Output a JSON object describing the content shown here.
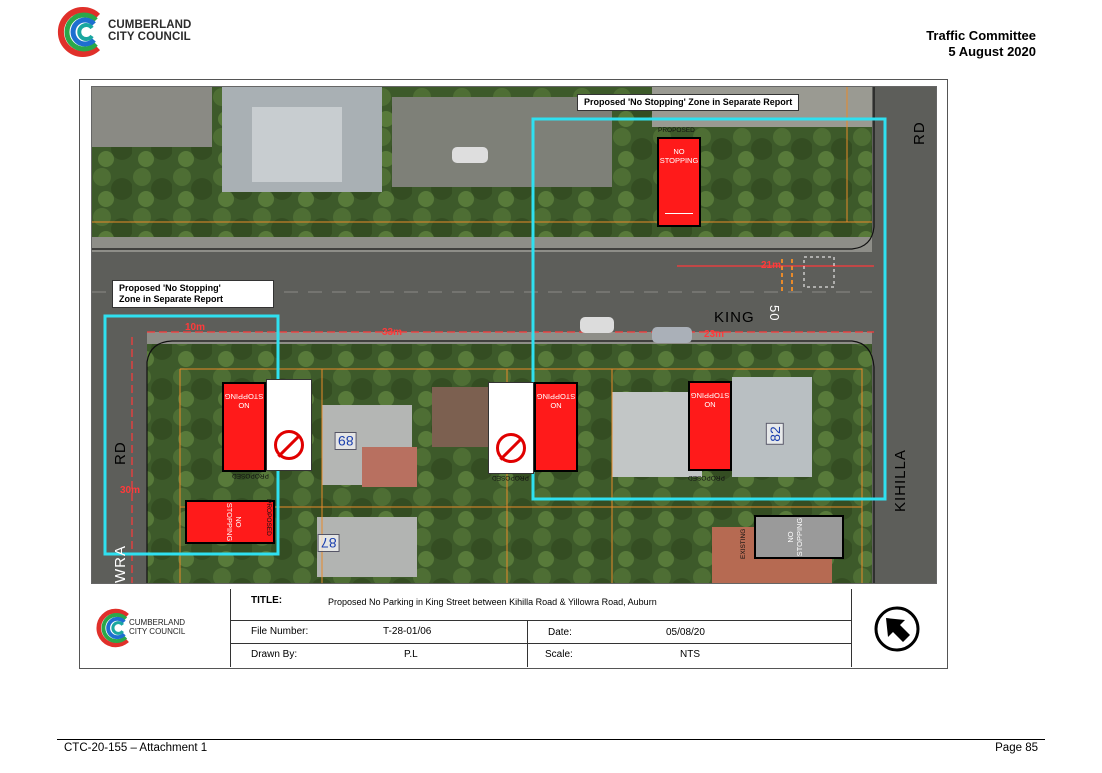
{
  "header": {
    "logo_line1": "CUMBERLAND",
    "logo_line2": "CITY COUNCIL",
    "committee": "Traffic Committee",
    "date": "5 August 2020"
  },
  "map": {
    "callout_top": "Proposed 'No Stopping' Zone in Separate Report",
    "callout_left_line1": "Proposed 'No Stopping'",
    "callout_left_line2": "Zone in Separate Report",
    "streets": {
      "king": "KING",
      "rd_top": "RD",
      "rd_left": "RD",
      "kihilla": "KIHILLA",
      "wra": "WRA"
    },
    "dimensions": {
      "d21": "21m",
      "d10": "10m",
      "d33": "33m",
      "d23": "23m",
      "d30": "30m"
    },
    "house_numbers": [
      "89",
      "82",
      "87"
    ],
    "sign_no": "NO",
    "sign_stopping": "STOPPING",
    "label_proposed": "PROPOSED",
    "label_existing": "EXISTING",
    "road_marking": "50"
  },
  "titleblock": {
    "logo_line1": "CUMBERLAND",
    "logo_line2": "CITY COUNCIL",
    "title_label": "TITLE:",
    "title_value": "Proposed No Parking in King Street between Kihilla Road & Yillowra Road, Auburn",
    "file_label": "File Number:",
    "file_value": "T-28-01/06",
    "date_label": "Date:",
    "date_value": "05/08/20",
    "drawn_label": "Drawn By:",
    "drawn_value": "P.L",
    "scale_label": "Scale:",
    "scale_value": "NTS"
  },
  "footer": {
    "left": "CTC-20-155 – Attachment 1",
    "right": "Page 85"
  },
  "colors": {
    "accent_cyan": "#2fe0f0",
    "sign_red": "#ff1a1a",
    "dimension_red": "#ff3a3a",
    "boundary_orange": "#e88a2a",
    "logo_red": "#e0302a",
    "logo_green": "#2aa84a",
    "logo_blue": "#1e6fd0",
    "logo_teal": "#1aa7a0"
  }
}
